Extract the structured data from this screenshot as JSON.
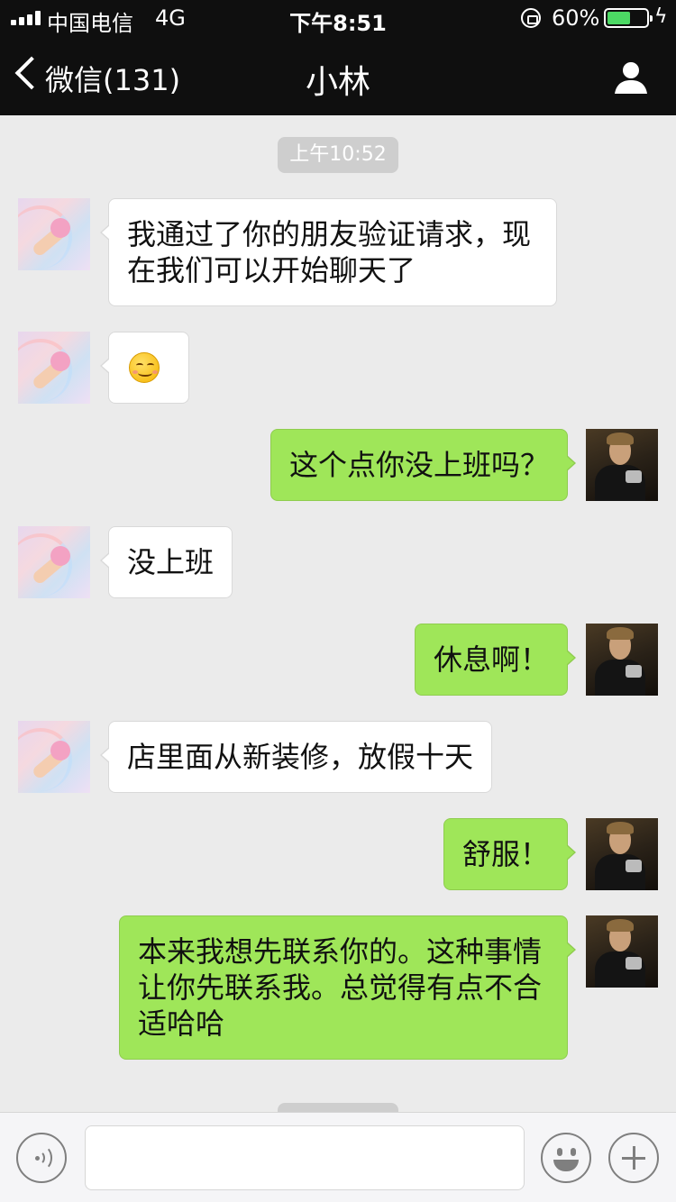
{
  "status_bar": {
    "carrier": "中国电信",
    "network": "4G",
    "time": "下午8:51",
    "battery_percent_label": "60%",
    "battery_level": 0.6,
    "battery_color": "#4cd964"
  },
  "nav": {
    "back_label": "微信(131)",
    "title": "小林",
    "back_icon": "chevron-left-icon",
    "profile_icon": "person-icon"
  },
  "chat": {
    "timestamp": "上午10:52",
    "messages": [
      {
        "from": "contact",
        "text": "我通过了你的朋友验证请求，现在我们可以开始聊天了"
      },
      {
        "from": "contact",
        "text": "",
        "emoji": "smiling-face-icon"
      },
      {
        "from": "me",
        "text": "这个点你没上班吗？"
      },
      {
        "from": "contact",
        "text": "没上班"
      },
      {
        "from": "me",
        "text": "休息啊！"
      },
      {
        "from": "contact",
        "text": "店里面从新装修，放假十天"
      },
      {
        "from": "me",
        "text": "舒服！"
      },
      {
        "from": "me",
        "text": "本来我想先联系你的。这种事情让你先联系我。总觉得有点不合适哈哈"
      }
    ]
  },
  "input_bar": {
    "voice_icon": "voice-icon",
    "emoji_icon": "emoji-icon",
    "plus_icon": "plus-icon",
    "value": ""
  },
  "colors": {
    "nav_bg": "#0f0f0f",
    "chat_bg": "#ebebeb",
    "outgoing_bubble": "#9fe659",
    "incoming_bubble": "#ffffff"
  }
}
